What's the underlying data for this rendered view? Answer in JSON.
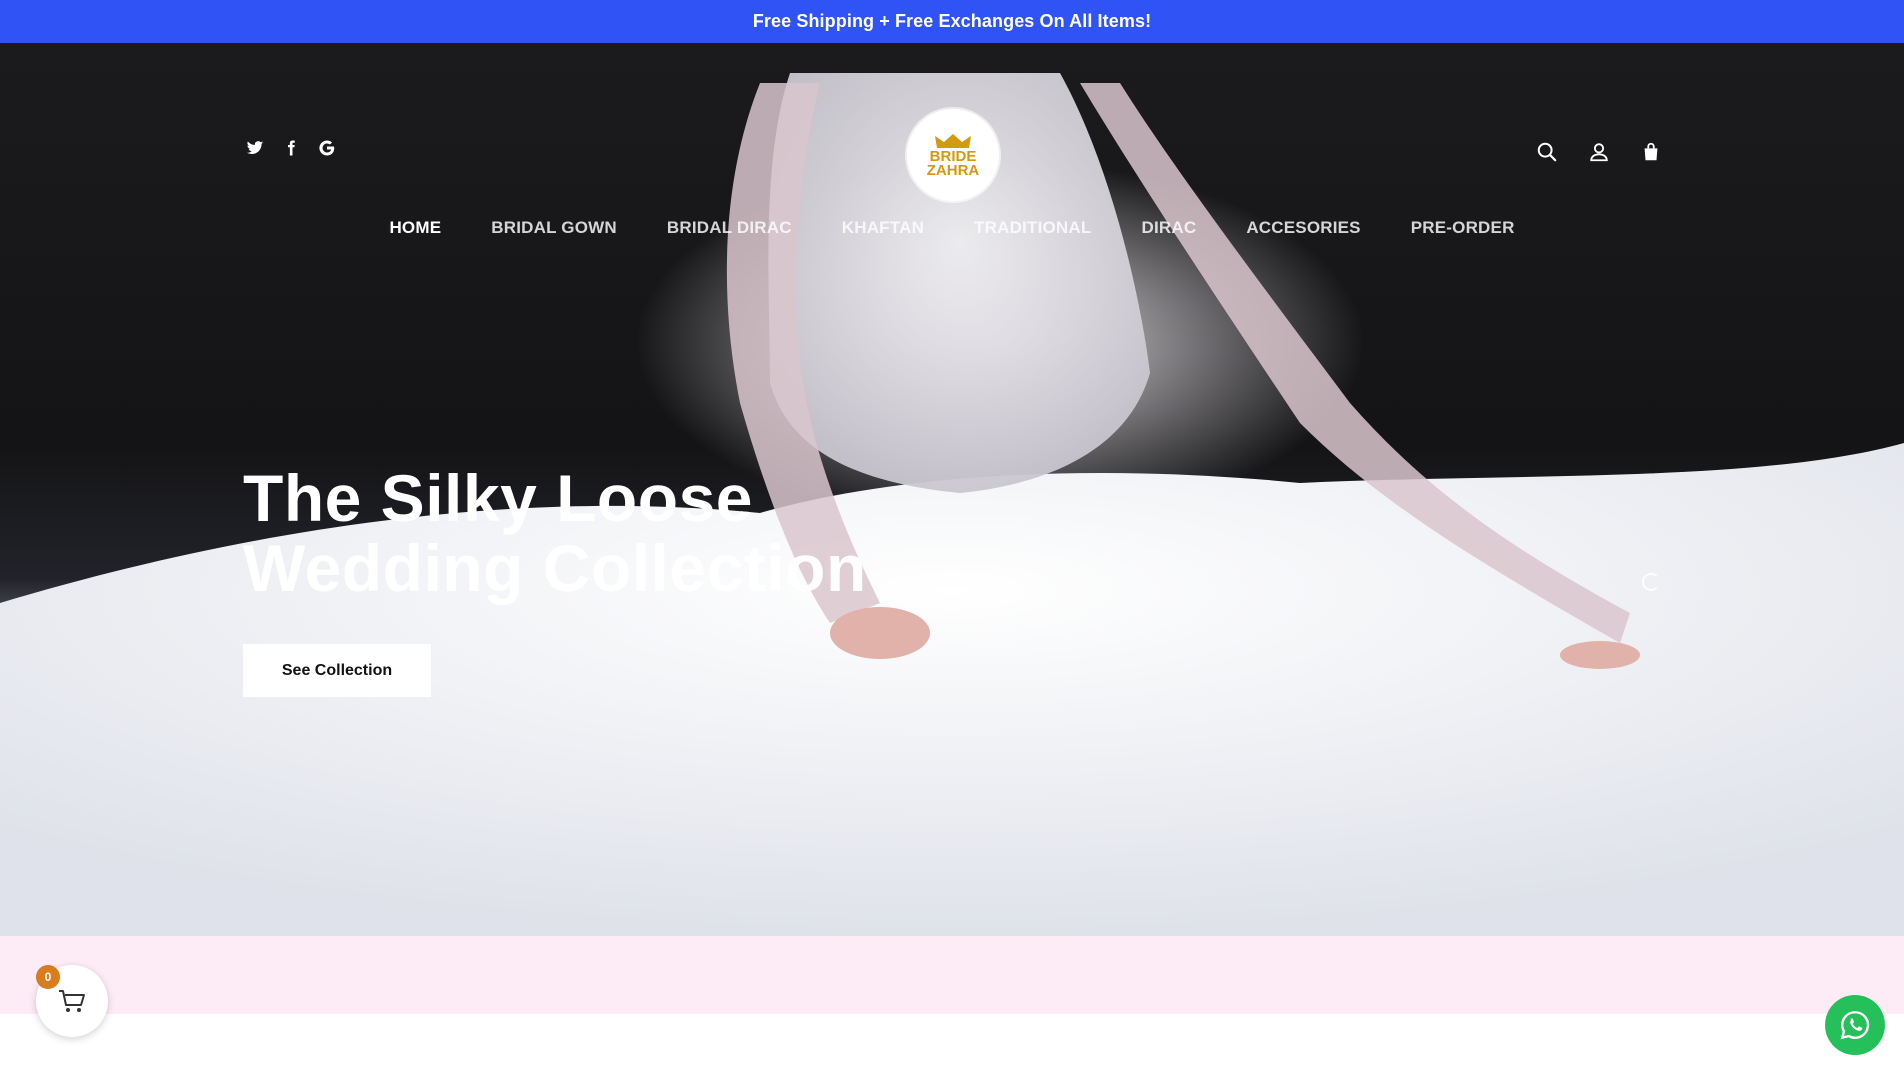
{
  "announcement": {
    "text": "Free Shipping + Free Exchanges On All Items!"
  },
  "colors": {
    "announcement_bg": "#2f53f5",
    "logo_gold": "#d29a10",
    "band_pink": "#fdebf6",
    "badge": "#d87c1e",
    "whatsapp": "#25c05a"
  },
  "social": [
    {
      "name": "twitter-icon"
    },
    {
      "name": "facebook-icon"
    },
    {
      "name": "google-icon"
    }
  ],
  "logo": {
    "line1": "BRIDE",
    "line2": "ZAHRA"
  },
  "header_icons": [
    {
      "name": "search-icon"
    },
    {
      "name": "account-icon"
    },
    {
      "name": "shopping-bag-icon"
    }
  ],
  "nav": {
    "items": [
      {
        "label": "HOME"
      },
      {
        "label": "BRIDAL GOWN"
      },
      {
        "label": "BRIDAL DIRAC"
      },
      {
        "label": "KHAFTAN"
      },
      {
        "label": "TRADITIONAL"
      },
      {
        "label": "DIRAC"
      },
      {
        "label": "ACCESORIES"
      },
      {
        "label": "PRE-ORDER"
      }
    ]
  },
  "hero": {
    "title_line1": "The Silky Loose",
    "title_line2": "Wedding Collection",
    "cta_label": "See Collection"
  },
  "cart": {
    "count": "0",
    "icon": "cart-icon"
  },
  "whatsapp": {
    "icon": "whatsapp-icon"
  }
}
